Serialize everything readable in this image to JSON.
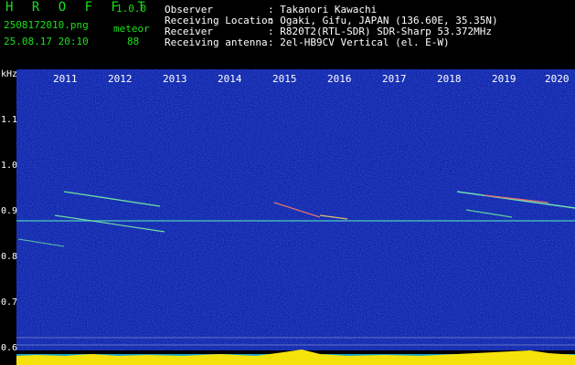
{
  "header": {
    "app_name": "H R O F F T",
    "version": "1.0.0",
    "filename": "2508172010.png",
    "mode": "meteor",
    "datetime": "25.08.17 20:10",
    "count": "88",
    "observer_label": "Observer",
    "observer_value": ": Takanori Kawachi",
    "location_label": "Receiving Location",
    "location_value": ": Ogaki, Gifu, JAPAN (136.60E, 35.35N)",
    "receiver_label": "Receiver",
    "receiver_value": ": R820T2(RTL-SDR) SDR-Sharp 53.372MHz",
    "antenna_label": "Receiving antenna",
    "antenna_value": ": 2el-HB9CV Vertical (el. E-W)"
  },
  "axis": {
    "unit": "kHz",
    "years": [
      "2011",
      "2012",
      "2013",
      "2014",
      "2015",
      "2016",
      "2017",
      "2018",
      "2019",
      "2020"
    ],
    "y_ticks": [
      "1.1",
      "1.0",
      "0.9",
      "0.8",
      "0.7",
      "0.6"
    ]
  },
  "colors": {
    "background": "#1424a8",
    "text_green": "#19e019",
    "text_white": "#ffffff",
    "baseline": "#f5e20a"
  }
}
